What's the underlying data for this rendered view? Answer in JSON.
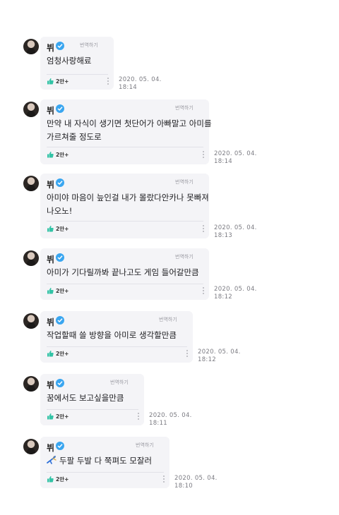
{
  "common": {
    "username": "뷔",
    "translate_label": "번역하기",
    "likes_count": "2만+"
  },
  "messages": [
    {
      "lines": [
        "엄청사랑해료"
      ],
      "date": "2020. 05. 04.",
      "time": "18:14"
    },
    {
      "lines": [
        "만약 내 자식이 생기면 첫단어가 아빠말고 아미를",
        "가르쳐줄 정도로"
      ],
      "date": "2020. 05. 04.",
      "time": "18:14"
    },
    {
      "lines": [
        "아미야 마음이 늪인걸 내가 몰랐다안카나 못빠져",
        "나오노!"
      ],
      "date": "2020. 05. 04.",
      "time": "18:13"
    },
    {
      "lines": [
        "아미가 기다릴까봐 끝나고도 게임 들어갈만큼"
      ],
      "date": "2020. 05. 04.",
      "time": "18:12"
    },
    {
      "lines": [
        "작업할때 쓸 방향을 아미로 생각할만큼"
      ],
      "date": "2020. 05. 04.",
      "time": "18:12"
    },
    {
      "lines": [
        "꿈에서도 보고싶을만큼"
      ],
      "date": "2020. 05. 04.",
      "time": "18:11"
    },
    {
      "lines": [
        "두팔 두발 다 쭉펴도 모잘러"
      ],
      "date": "2020. 05. 04.",
      "time": "18:10",
      "emoji": "stretching-figure-emoji"
    }
  ],
  "colors": {
    "bubble_bg": "#f4f4f7",
    "verified_badge": "#3aa6f0",
    "like_icon": "#33c3a6",
    "timestamp": "#7b7b82"
  }
}
